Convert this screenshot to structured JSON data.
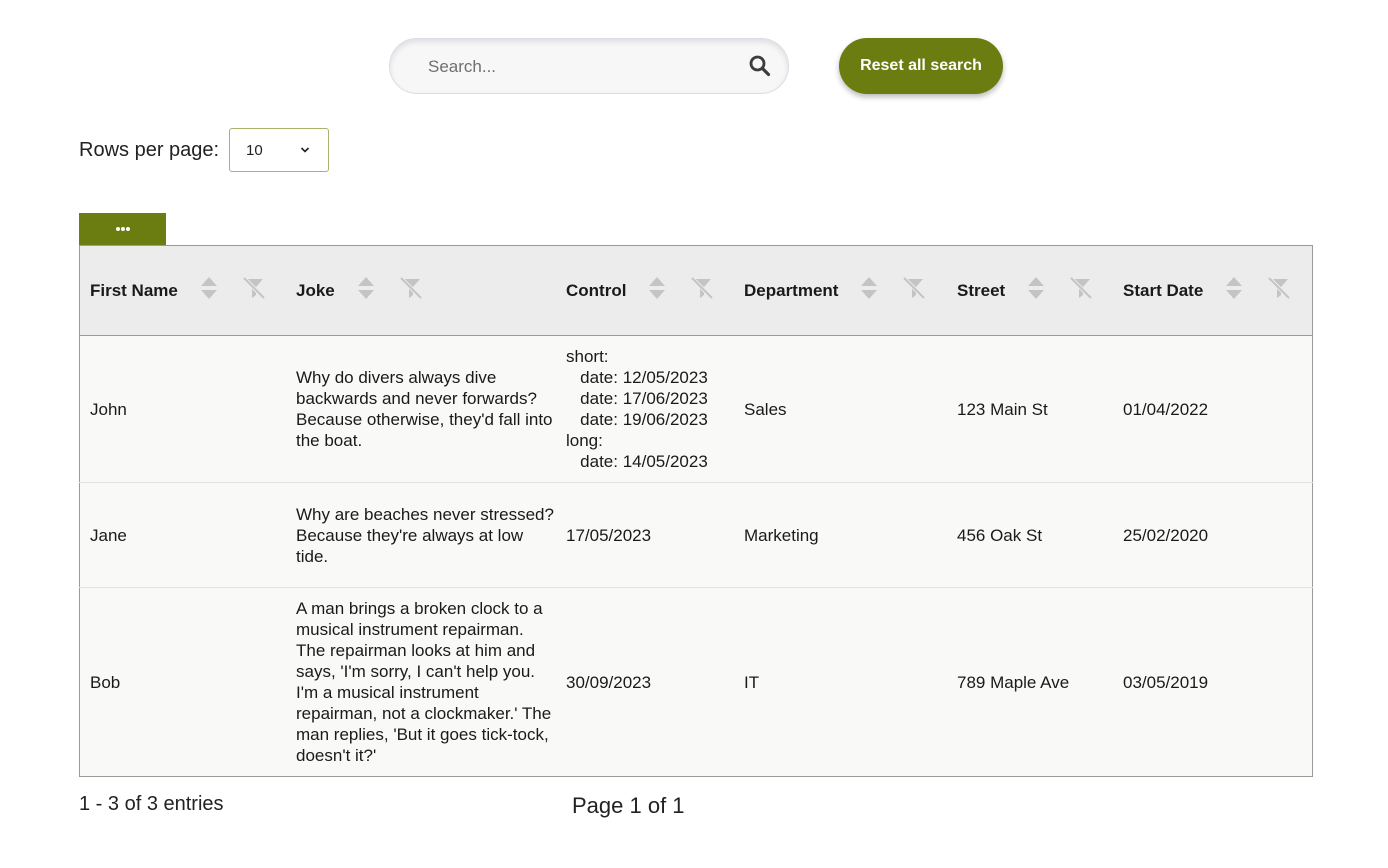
{
  "search": {
    "placeholder": "Search...",
    "value": "",
    "reset_label": "Reset all search"
  },
  "pagination": {
    "rows_per_page_label": "Rows per page:",
    "rows_per_page_value": "10",
    "entries_text": "1 - 3 of 3 entries",
    "page_text": "Page 1 of 1"
  },
  "table": {
    "columns": [
      {
        "label": "First Name"
      },
      {
        "label": "Joke"
      },
      {
        "label": "Control"
      },
      {
        "label": "Department"
      },
      {
        "label": "Street"
      },
      {
        "label": "Start Date"
      }
    ],
    "rows": [
      {
        "first_name": "John",
        "joke": "Why do divers always dive backwards and never forwards? Because otherwise, they'd fall into the boat.",
        "control": "short:\n   date: 12/05/2023\n   date: 17/06/2023\n   date: 19/06/2023\nlong:\n   date: 14/05/2023",
        "department": "Sales",
        "street": "123 Main St",
        "start_date": "01/04/2022"
      },
      {
        "first_name": "Jane",
        "joke": "Why are beaches never stressed?\nBecause they're always at low tide.",
        "control": "17/05/2023",
        "department": "Marketing",
        "street": "456 Oak St",
        "start_date": "25/02/2020"
      },
      {
        "first_name": "Bob",
        "joke": "A man brings a broken clock to a musical instrument repairman. The repairman looks at him and says, 'I'm sorry, I can't help you. I'm a musical instrument repairman, not a clockmaker.' The man replies, 'But it goes tick-tock, doesn't it?'",
        "control": "30/09/2023",
        "department": "IT",
        "street": "789 Maple Ave",
        "start_date": "03/05/2019"
      }
    ]
  },
  "colors": {
    "accent": "#6b7c10",
    "header_bg": "#ececec",
    "row_bg": "#f9f9f7"
  },
  "icons": {
    "search": "search-icon",
    "dropdown": "chevron-down-icon",
    "column_menu": "more-horizontal-icon",
    "sort": "sort-icon",
    "clear_filter": "filter-off-icon"
  }
}
